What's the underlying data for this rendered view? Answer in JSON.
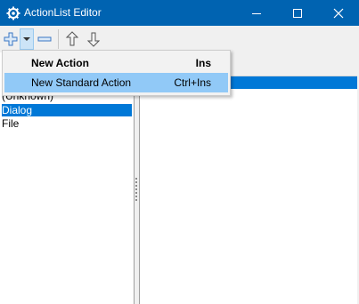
{
  "window": {
    "title": "ActionList Editor",
    "titlebar_color": "#0063b1",
    "controls": [
      "minimize-icon",
      "maximize-icon",
      "close-icon"
    ]
  },
  "toolbar": {
    "buttons": [
      "add-icon",
      "dropdown-arrow-icon",
      "remove-icon",
      "move-up-icon",
      "move-down-icon"
    ]
  },
  "popup_menu": {
    "items": [
      {
        "label": "New Action",
        "shortcut": "Ins",
        "bold": true
      },
      {
        "label": "New Standard Action",
        "shortcut": "Ctrl+Ins",
        "highlighted": true
      }
    ],
    "highlight_color": "#91c9f7"
  },
  "categories": {
    "items": [
      "(Unknown)",
      "Dialog",
      "File"
    ],
    "selected": "Dialog",
    "selection_color": "#0078d7"
  }
}
